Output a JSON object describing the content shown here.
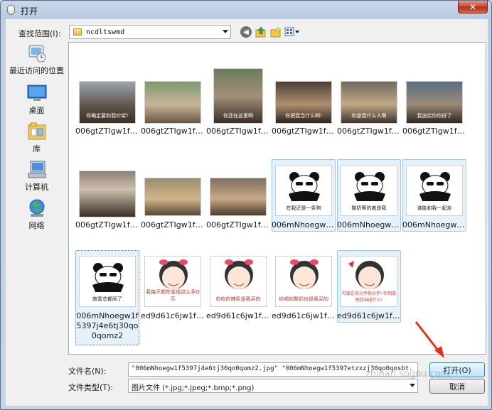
{
  "window": {
    "title": "打开",
    "close_label": "✕"
  },
  "lookin": {
    "label": "查找范围(I):",
    "value": "ncdltswmd"
  },
  "places": [
    {
      "label": "最近访问的位置"
    },
    {
      "label": "桌面"
    },
    {
      "label": "库"
    },
    {
      "label": "计算机"
    },
    {
      "label": "网络"
    }
  ],
  "files": [
    {
      "name": "006gtZTIgw1f5...",
      "caption": "你确定要和我吵架?"
    },
    {
      "name": "006gtZTIgw1f5...",
      "caption": ""
    },
    {
      "name": "006gtZTIgw1f5...",
      "caption": "你还在这里啊"
    },
    {
      "name": "006gtZTIgw1f5...",
      "caption": "你把我当什么啊!"
    },
    {
      "name": "006gtZTIgw1f5...",
      "caption": "你是我什么人啊"
    },
    {
      "name": "006gtZTIgw1f5...",
      "caption": "我送给你你好了"
    },
    {
      "name": "006gtZTIgw1f5...",
      "caption": ""
    },
    {
      "name": "006gtZTIgw1f5...",
      "caption": ""
    },
    {
      "name": "006gtZTIgw1f5...",
      "caption": ""
    },
    {
      "name": "006mNhoegw1...",
      "caption": "在我还是一条狗"
    },
    {
      "name": "006mNhoegw1...",
      "caption": "酸奶等的着是我"
    },
    {
      "name": "006mNhoegw1f...",
      "caption": "谁能和我一起走"
    },
    {
      "name": "006mNhoegw1f5397j4e6tj30qo0qomz2",
      "caption": "寂寞总都闹了"
    },
    {
      "name": "ed9d61c6jw1f5...",
      "caption": "我每天都在变成这么多Q币"
    },
    {
      "name": "ed9d61c6jw1f5...",
      "caption": "你吃的辣条是我买的"
    },
    {
      "name": "ed9d61c6jw1f5...",
      "caption": "你喝的酸奶也是我买的"
    },
    {
      "name": "ed9d61c6jw1f5...",
      "caption": "可现在说分手就分手! 你到底把我当成什么!"
    }
  ],
  "filename": {
    "label": "文件名(N):",
    "value": "\"006mNhoegw1f5397j4e6tj30qo0qomz2.jpg\" \"006mNhoegw1f5397etzxzj30qo0qosbt."
  },
  "filetype": {
    "label": "文件类型(T):",
    "value": "图片文件 (*.jpg;*.jpeg;*.bmp;*.png)"
  },
  "buttons": {
    "open": "打开(O)",
    "cancel": "取消"
  },
  "watermark": "zhinan.sogou.com",
  "colors": {
    "selection": "#e5f1fb",
    "selection_border": "#99c9ef",
    "arrow": "#e53020"
  }
}
